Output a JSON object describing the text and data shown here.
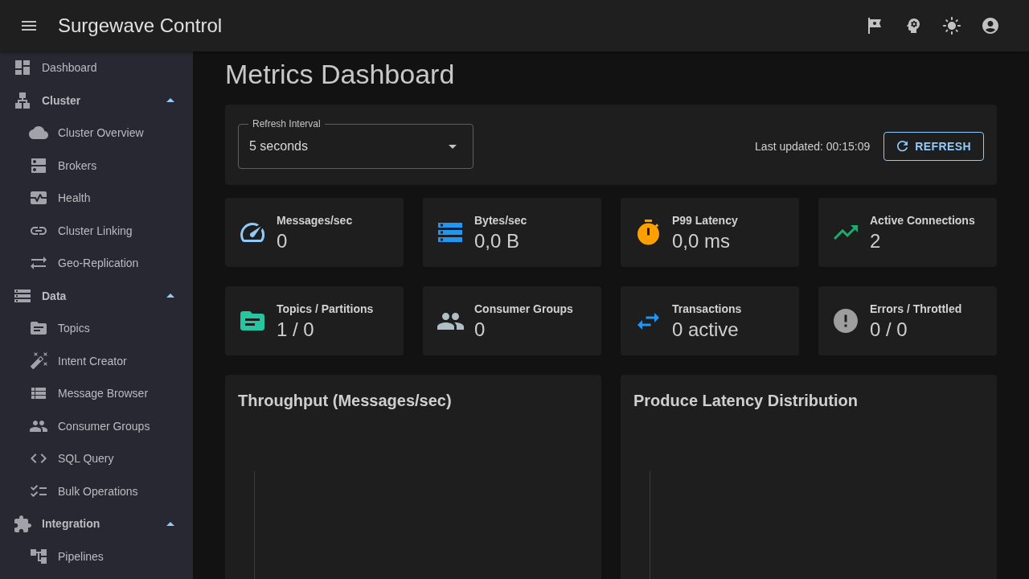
{
  "app_bar": {
    "title": "Surgewave Control"
  },
  "sidebar": {
    "items": [
      {
        "label": "Dashboard"
      },
      {
        "label": "Cluster",
        "expanded": true,
        "children": [
          {
            "label": "Cluster Overview"
          },
          {
            "label": "Brokers"
          },
          {
            "label": "Health"
          },
          {
            "label": "Cluster Linking"
          },
          {
            "label": "Geo-Replication"
          }
        ]
      },
      {
        "label": "Data",
        "expanded": true,
        "children": [
          {
            "label": "Topics"
          },
          {
            "label": "Intent Creator"
          },
          {
            "label": "Message Browser"
          },
          {
            "label": "Consumer Groups"
          },
          {
            "label": "SQL Query"
          },
          {
            "label": "Bulk Operations"
          }
        ]
      },
      {
        "label": "Integration",
        "expanded": true,
        "children": [
          {
            "label": "Pipelines"
          }
        ]
      }
    ]
  },
  "page": {
    "title": "Metrics Dashboard"
  },
  "refresh_panel": {
    "interval_select": {
      "label": "Refresh Interval",
      "value": "5 seconds"
    },
    "last_updated": "Last updated: 00:15:09",
    "refresh_button": "REFRESH"
  },
  "stats": [
    {
      "label": "Messages/sec",
      "value": "0",
      "color": "#90caf9"
    },
    {
      "label": "Bytes/sec",
      "value": "0,0 B",
      "color": "#2196f3"
    },
    {
      "label": "P99 Latency",
      "value": "0,0 ms",
      "color": "#ffa000"
    },
    {
      "label": "Active Connections",
      "value": "2",
      "color": "#1eaa6e"
    },
    {
      "label": "Topics / Partitions",
      "value": "1 / 0",
      "color": "#26c6a0"
    },
    {
      "label": "Consumer Groups",
      "value": "0",
      "color": "#b0bec5"
    },
    {
      "label": "Transactions",
      "value": "0 active",
      "color": "#2196f3"
    },
    {
      "label": "Errors / Throttled",
      "value": "0 / 0",
      "color": "#9e9e9e"
    }
  ],
  "charts": [
    {
      "title": "Throughput (Messages/sec)"
    },
    {
      "title": "Produce Latency Distribution"
    }
  ]
}
